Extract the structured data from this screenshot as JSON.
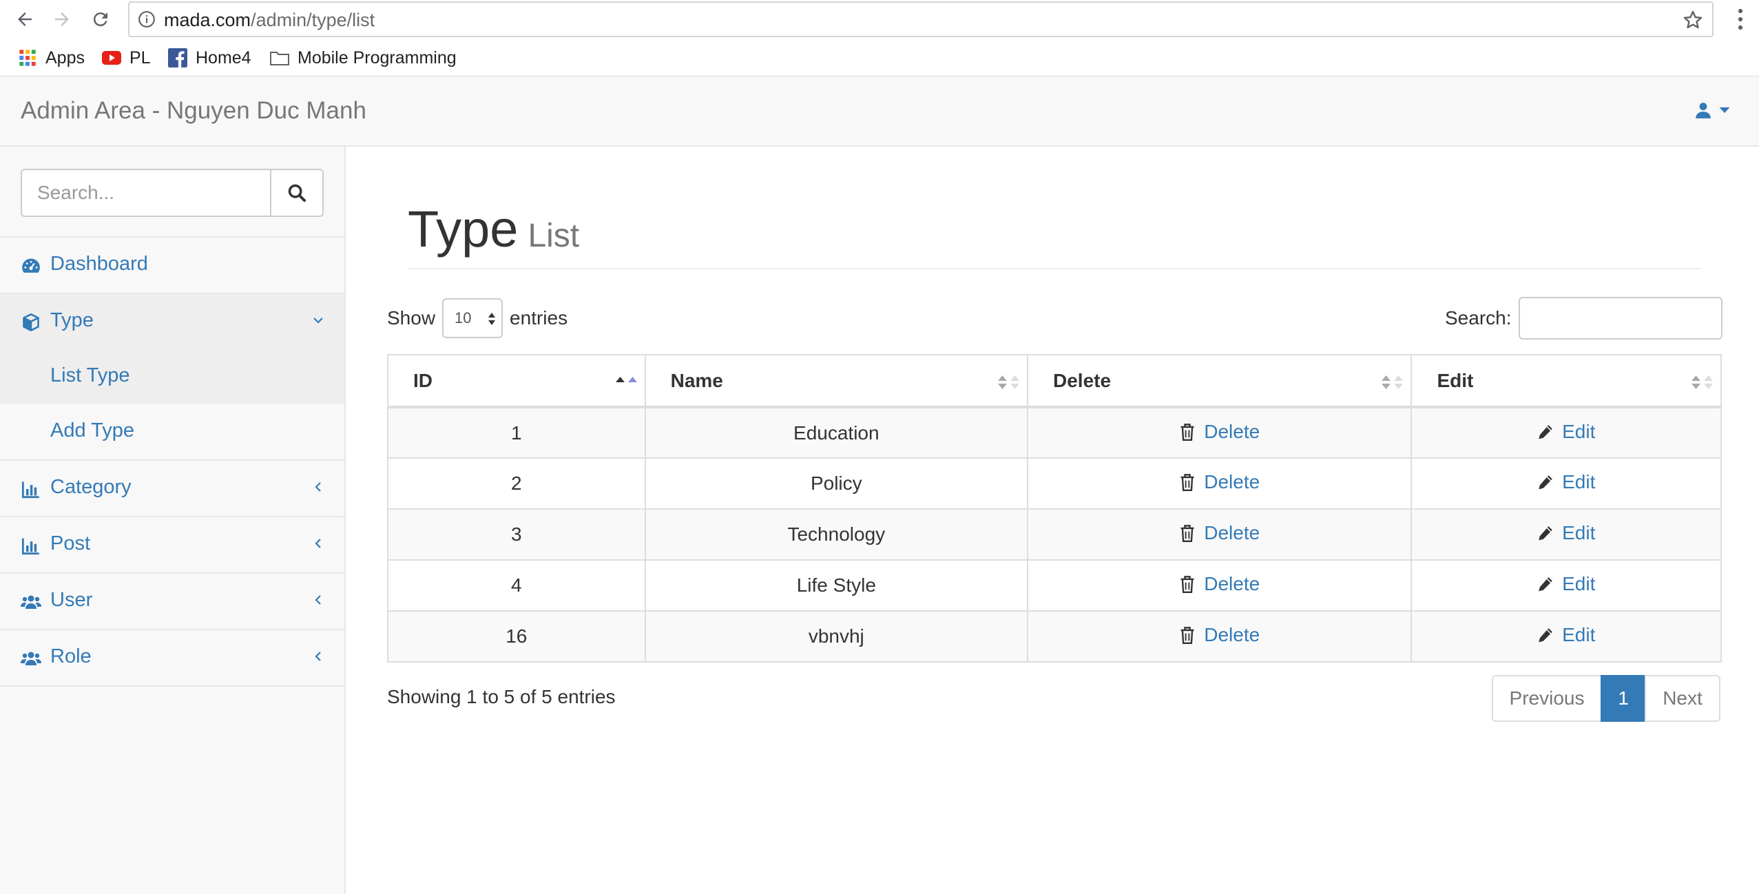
{
  "browser": {
    "url_host": "mada.com",
    "url_path": "/admin/type/list",
    "bookmarks": [
      {
        "label": "Apps",
        "icon": "apps-grid-icon"
      },
      {
        "label": "PL",
        "icon": "youtube-icon"
      },
      {
        "label": "Home4",
        "icon": "facebook-icon"
      },
      {
        "label": "Mobile Programming",
        "icon": "folder-icon"
      }
    ]
  },
  "header": {
    "brand": "Admin Area - Nguyen Duc Manh"
  },
  "sidebar": {
    "search_placeholder": "Search...",
    "items": [
      {
        "label": "Dashboard",
        "icon": "dashboard-icon"
      },
      {
        "label": "Type",
        "icon": "cube-icon",
        "expanded": true,
        "children": [
          {
            "label": "List Type"
          },
          {
            "label": "Add Type"
          }
        ]
      },
      {
        "label": "Category",
        "icon": "bar-chart-icon"
      },
      {
        "label": "Post",
        "icon": "bar-chart-icon"
      },
      {
        "label": "User",
        "icon": "users-icon"
      },
      {
        "label": "Role",
        "icon": "users-icon"
      }
    ]
  },
  "page": {
    "title": "Type",
    "subtitle": "List"
  },
  "table_controls": {
    "show_label": "Show",
    "length_value": "10",
    "entries_label": "entries",
    "search_label": "Search:"
  },
  "table": {
    "columns": [
      "ID",
      "Name",
      "Delete",
      "Edit"
    ],
    "rows": [
      {
        "id": "1",
        "name": "Education",
        "delete": "Delete",
        "edit": "Edit"
      },
      {
        "id": "2",
        "name": "Policy",
        "delete": "Delete",
        "edit": "Edit"
      },
      {
        "id": "3",
        "name": "Technology",
        "delete": "Delete",
        "edit": "Edit"
      },
      {
        "id": "4",
        "name": "Life Style",
        "delete": "Delete",
        "edit": "Edit"
      },
      {
        "id": "16",
        "name": "vbnvhj",
        "delete": "Delete",
        "edit": "Edit"
      }
    ]
  },
  "footer": {
    "info": "Showing 1 to 5 of 5 entries",
    "pagination": {
      "previous": "Previous",
      "current": "1",
      "next": "Next"
    }
  },
  "colors": {
    "link": "#337ab7",
    "active_page": "#337ab7",
    "sidebar_bg": "#f8f8f8"
  }
}
